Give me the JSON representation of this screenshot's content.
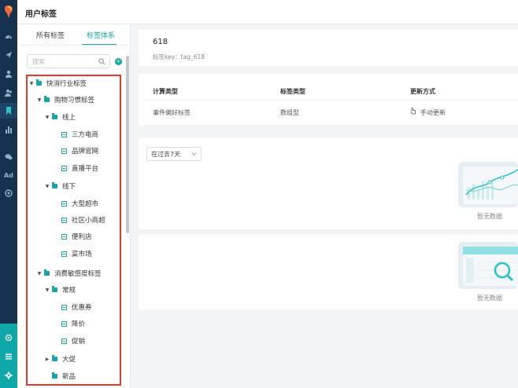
{
  "header": {
    "title": "用户标签"
  },
  "sidebar_rail": {
    "icons": [
      "logo-icon",
      "dashboard-icon",
      "send-icon",
      "user-icon",
      "users-icon",
      "bookmark-icon",
      "bar-chart-icon",
      "chat-icon",
      "ad-icon",
      "target-icon",
      "settings-cog-icon",
      "menu-icon",
      "gear-icon"
    ],
    "ad_label": "Ad"
  },
  "panel": {
    "tabs": [
      {
        "label": "所有标签"
      },
      {
        "label": "标签体系"
      }
    ],
    "active_tab": "标签体系",
    "search": {
      "placeholder": "搜索",
      "value": ""
    },
    "tree": [
      {
        "label": "快消行业标签",
        "type": "folder",
        "expanded": true
      },
      {
        "label": "购物习惯标签",
        "type": "folder",
        "expanded": true
      },
      {
        "label": "线上",
        "type": "folder",
        "expanded": true
      },
      {
        "label": "三方电商",
        "type": "tag"
      },
      {
        "label": "品牌官网",
        "type": "tag"
      },
      {
        "label": "直播平台",
        "type": "tag"
      },
      {
        "label": "线下",
        "type": "folder",
        "expanded": true
      },
      {
        "label": "大型超市",
        "type": "tag"
      },
      {
        "label": "社区小商超",
        "type": "tag"
      },
      {
        "label": "便利店",
        "type": "tag"
      },
      {
        "label": "菜市场",
        "type": "tag"
      },
      {
        "label": "消费敏感度标签",
        "type": "folder",
        "expanded": true
      },
      {
        "label": "常规",
        "type": "folder",
        "expanded": true
      },
      {
        "label": "优惠券",
        "type": "tag"
      },
      {
        "label": "降价",
        "type": "tag"
      },
      {
        "label": "促销",
        "type": "tag"
      },
      {
        "label": "大促",
        "type": "folder",
        "expanded": false
      },
      {
        "label": "新品",
        "type": "folder"
      }
    ]
  },
  "detail": {
    "name": "618",
    "key_text": "标签key：tag_618",
    "table": {
      "headers": [
        "计算类型",
        "标签类型",
        "更新方式"
      ],
      "row": [
        "事件偏好标签",
        "数组型",
        "手动更新"
      ]
    },
    "time_select": {
      "value": "在过去7天"
    },
    "empty_chart_text": "暂无数据",
    "empty_table_text": "暂无数据"
  },
  "colors": {
    "accent": "#17a5a5",
    "rail": "#16324f",
    "highlight_frame": "#e8372c"
  }
}
